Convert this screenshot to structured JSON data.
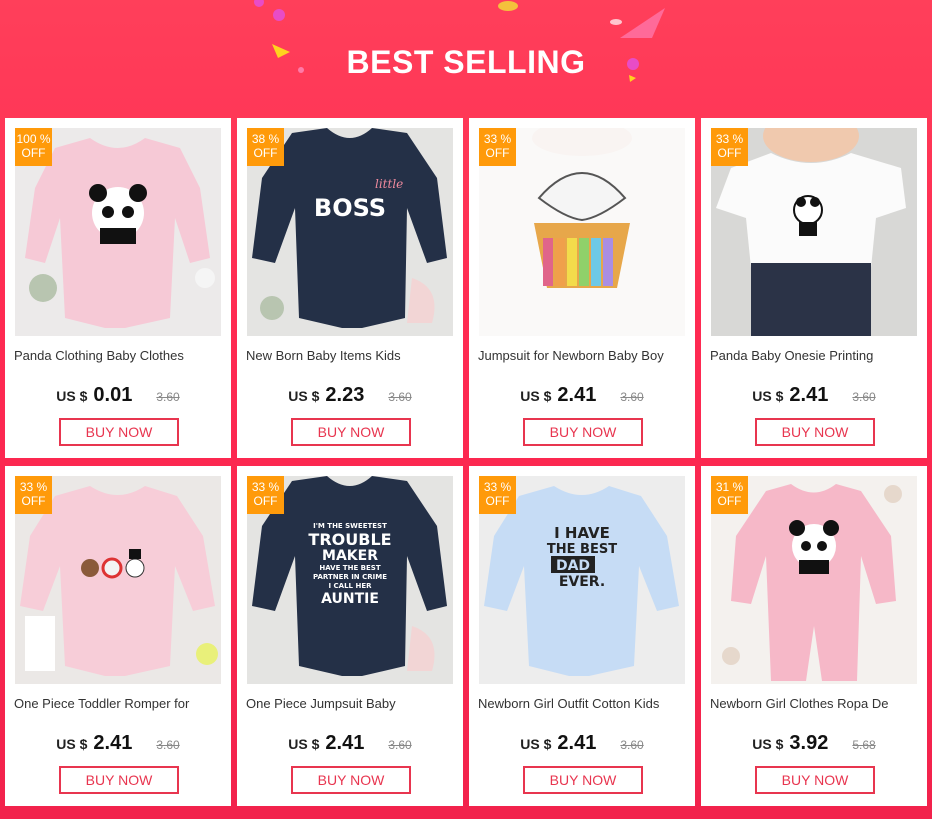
{
  "header": {
    "title": "BEST SELLING"
  },
  "products": [
    {
      "discount": "100 %\nOFF",
      "name": "Panda Clothing Baby Clothes",
      "currency": "US $",
      "price": "0.01",
      "old_price": "3.60",
      "buy": "BUY NOW"
    },
    {
      "discount": "38 %\nOFF",
      "name": "New Born Baby Items Kids",
      "currency": "US $",
      "price": "2.23",
      "old_price": "3.60",
      "buy": "BUY NOW"
    },
    {
      "discount": "33 %\nOFF",
      "name": "Jumpsuit for Newborn Baby Boy",
      "currency": "US $",
      "price": "2.41",
      "old_price": "3.60",
      "buy": "BUY NOW"
    },
    {
      "discount": "33 %\nOFF",
      "name": "Panda Baby Onesie Printing",
      "currency": "US $",
      "price": "2.41",
      "old_price": "3.60",
      "buy": "BUY NOW"
    },
    {
      "discount": "33 %\nOFF",
      "name": "One Piece Toddler Romper for",
      "currency": "US $",
      "price": "2.41",
      "old_price": "3.60",
      "buy": "BUY NOW"
    },
    {
      "discount": "33 %\nOFF",
      "name": "One Piece Jumpsuit Baby",
      "currency": "US $",
      "price": "2.41",
      "old_price": "3.60",
      "buy": "BUY NOW"
    },
    {
      "discount": "33 %\nOFF",
      "name": "Newborn Girl Outfit Cotton Kids",
      "currency": "US $",
      "price": "2.41",
      "old_price": "3.60",
      "buy": "BUY NOW"
    },
    {
      "discount": "31 %\nOFF",
      "name": "Newborn Girl Clothes Ropa De",
      "currency": "US $",
      "price": "3.92",
      "old_price": "5.68",
      "buy": "BUY NOW"
    }
  ],
  "prints": {
    "boss_small": "little",
    "boss_big": "BOSS",
    "auntie": [
      "I'M THE SWEETEST",
      "TROUBLE",
      "MAKER",
      "HAVE THE BEST",
      "PARTNER IN CRIME",
      "I CALL HER",
      "AUNTIE"
    ],
    "dad": [
      "I HAVE",
      "THE BEST",
      "DAD",
      "EVER."
    ]
  },
  "colors": {
    "accent": "#e8354f",
    "badge": "#ff9a0a",
    "background": "#ff2a52"
  }
}
